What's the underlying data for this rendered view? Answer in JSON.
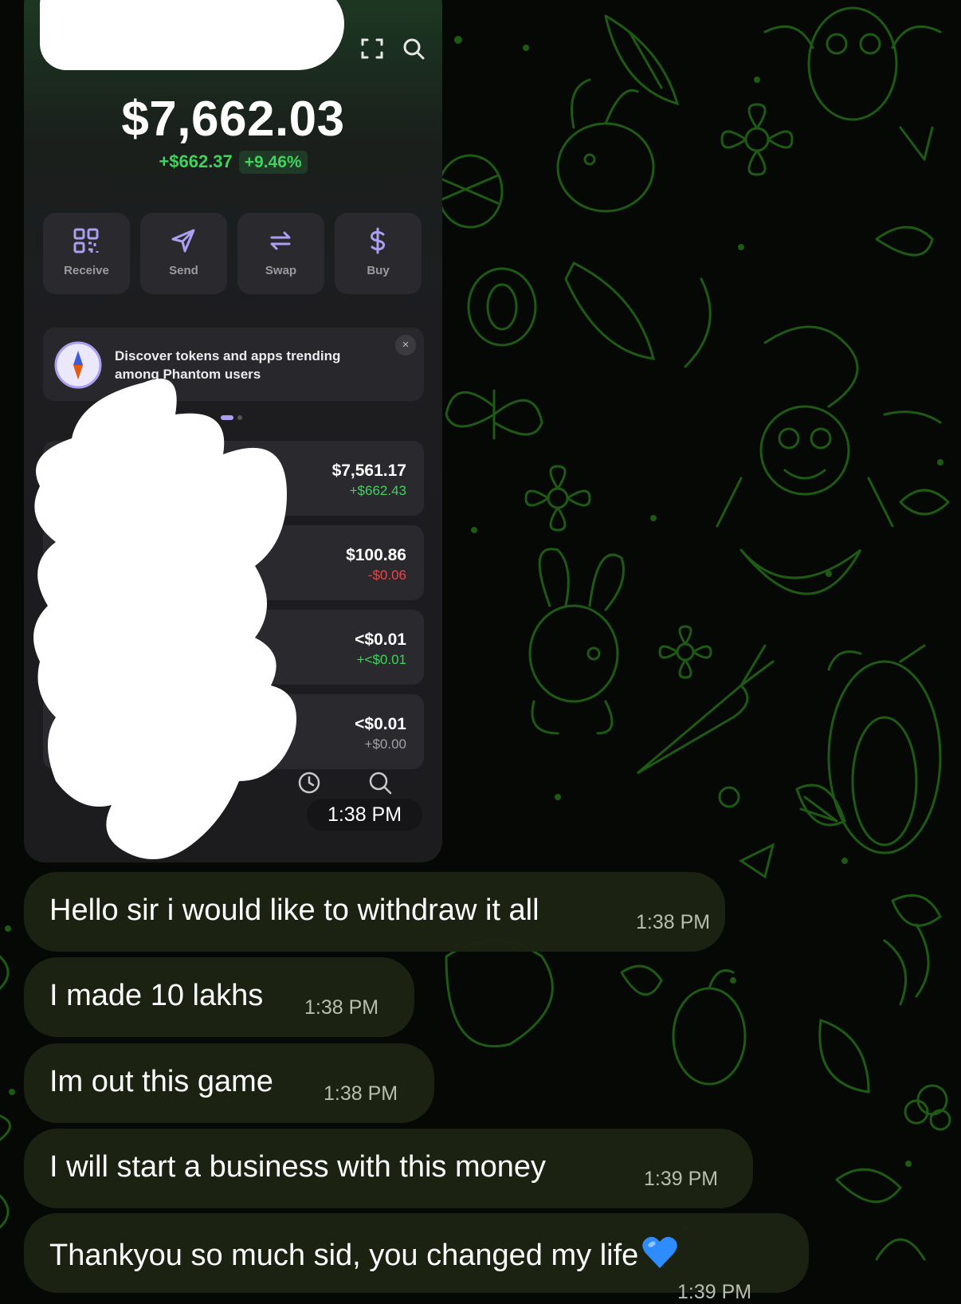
{
  "wallet": {
    "balance": "$7,662.03",
    "change_abs": "+$662.37",
    "change_pct": "+9.46%",
    "actions": [
      {
        "label": "Receive",
        "icon": "qr-code-icon"
      },
      {
        "label": "Send",
        "icon": "send-icon"
      },
      {
        "label": "Swap",
        "icon": "swap-icon"
      },
      {
        "label": "Buy",
        "icon": "dollar-icon"
      }
    ],
    "banner": {
      "text": "Discover tokens and apps trending among Phantom users",
      "close": "×"
    },
    "tokens": [
      {
        "value": "$7,561.17",
        "change": "+$662.43",
        "trend": "up"
      },
      {
        "value": "$100.86",
        "change": "-$0.06",
        "trend": "down"
      },
      {
        "value": "<$0.01",
        "change": "+<$0.01",
        "trend": "up"
      },
      {
        "value": "<$0.01",
        "change": "+$0.00",
        "trend": "flat"
      }
    ],
    "photo_time": "1:38 PM"
  },
  "messages": [
    {
      "text": "Hello sir i would like to withdraw it all",
      "time": "1:38 PM"
    },
    {
      "text": "I made 10 lakhs",
      "time": "1:38 PM"
    },
    {
      "text": "Im out this game",
      "time": "1:38 PM"
    },
    {
      "text": "I will start a business with this money",
      "time": "1:39 PM"
    },
    {
      "text": "Thankyou so much sid, you changed my life",
      "time": "1:39 PM",
      "emoji": "blue-heart-icon"
    }
  ],
  "colors": {
    "positive": "#3ed35c",
    "negative": "#e5484d",
    "accent": "#ab9ff2",
    "doodle": "#1f5a14"
  }
}
